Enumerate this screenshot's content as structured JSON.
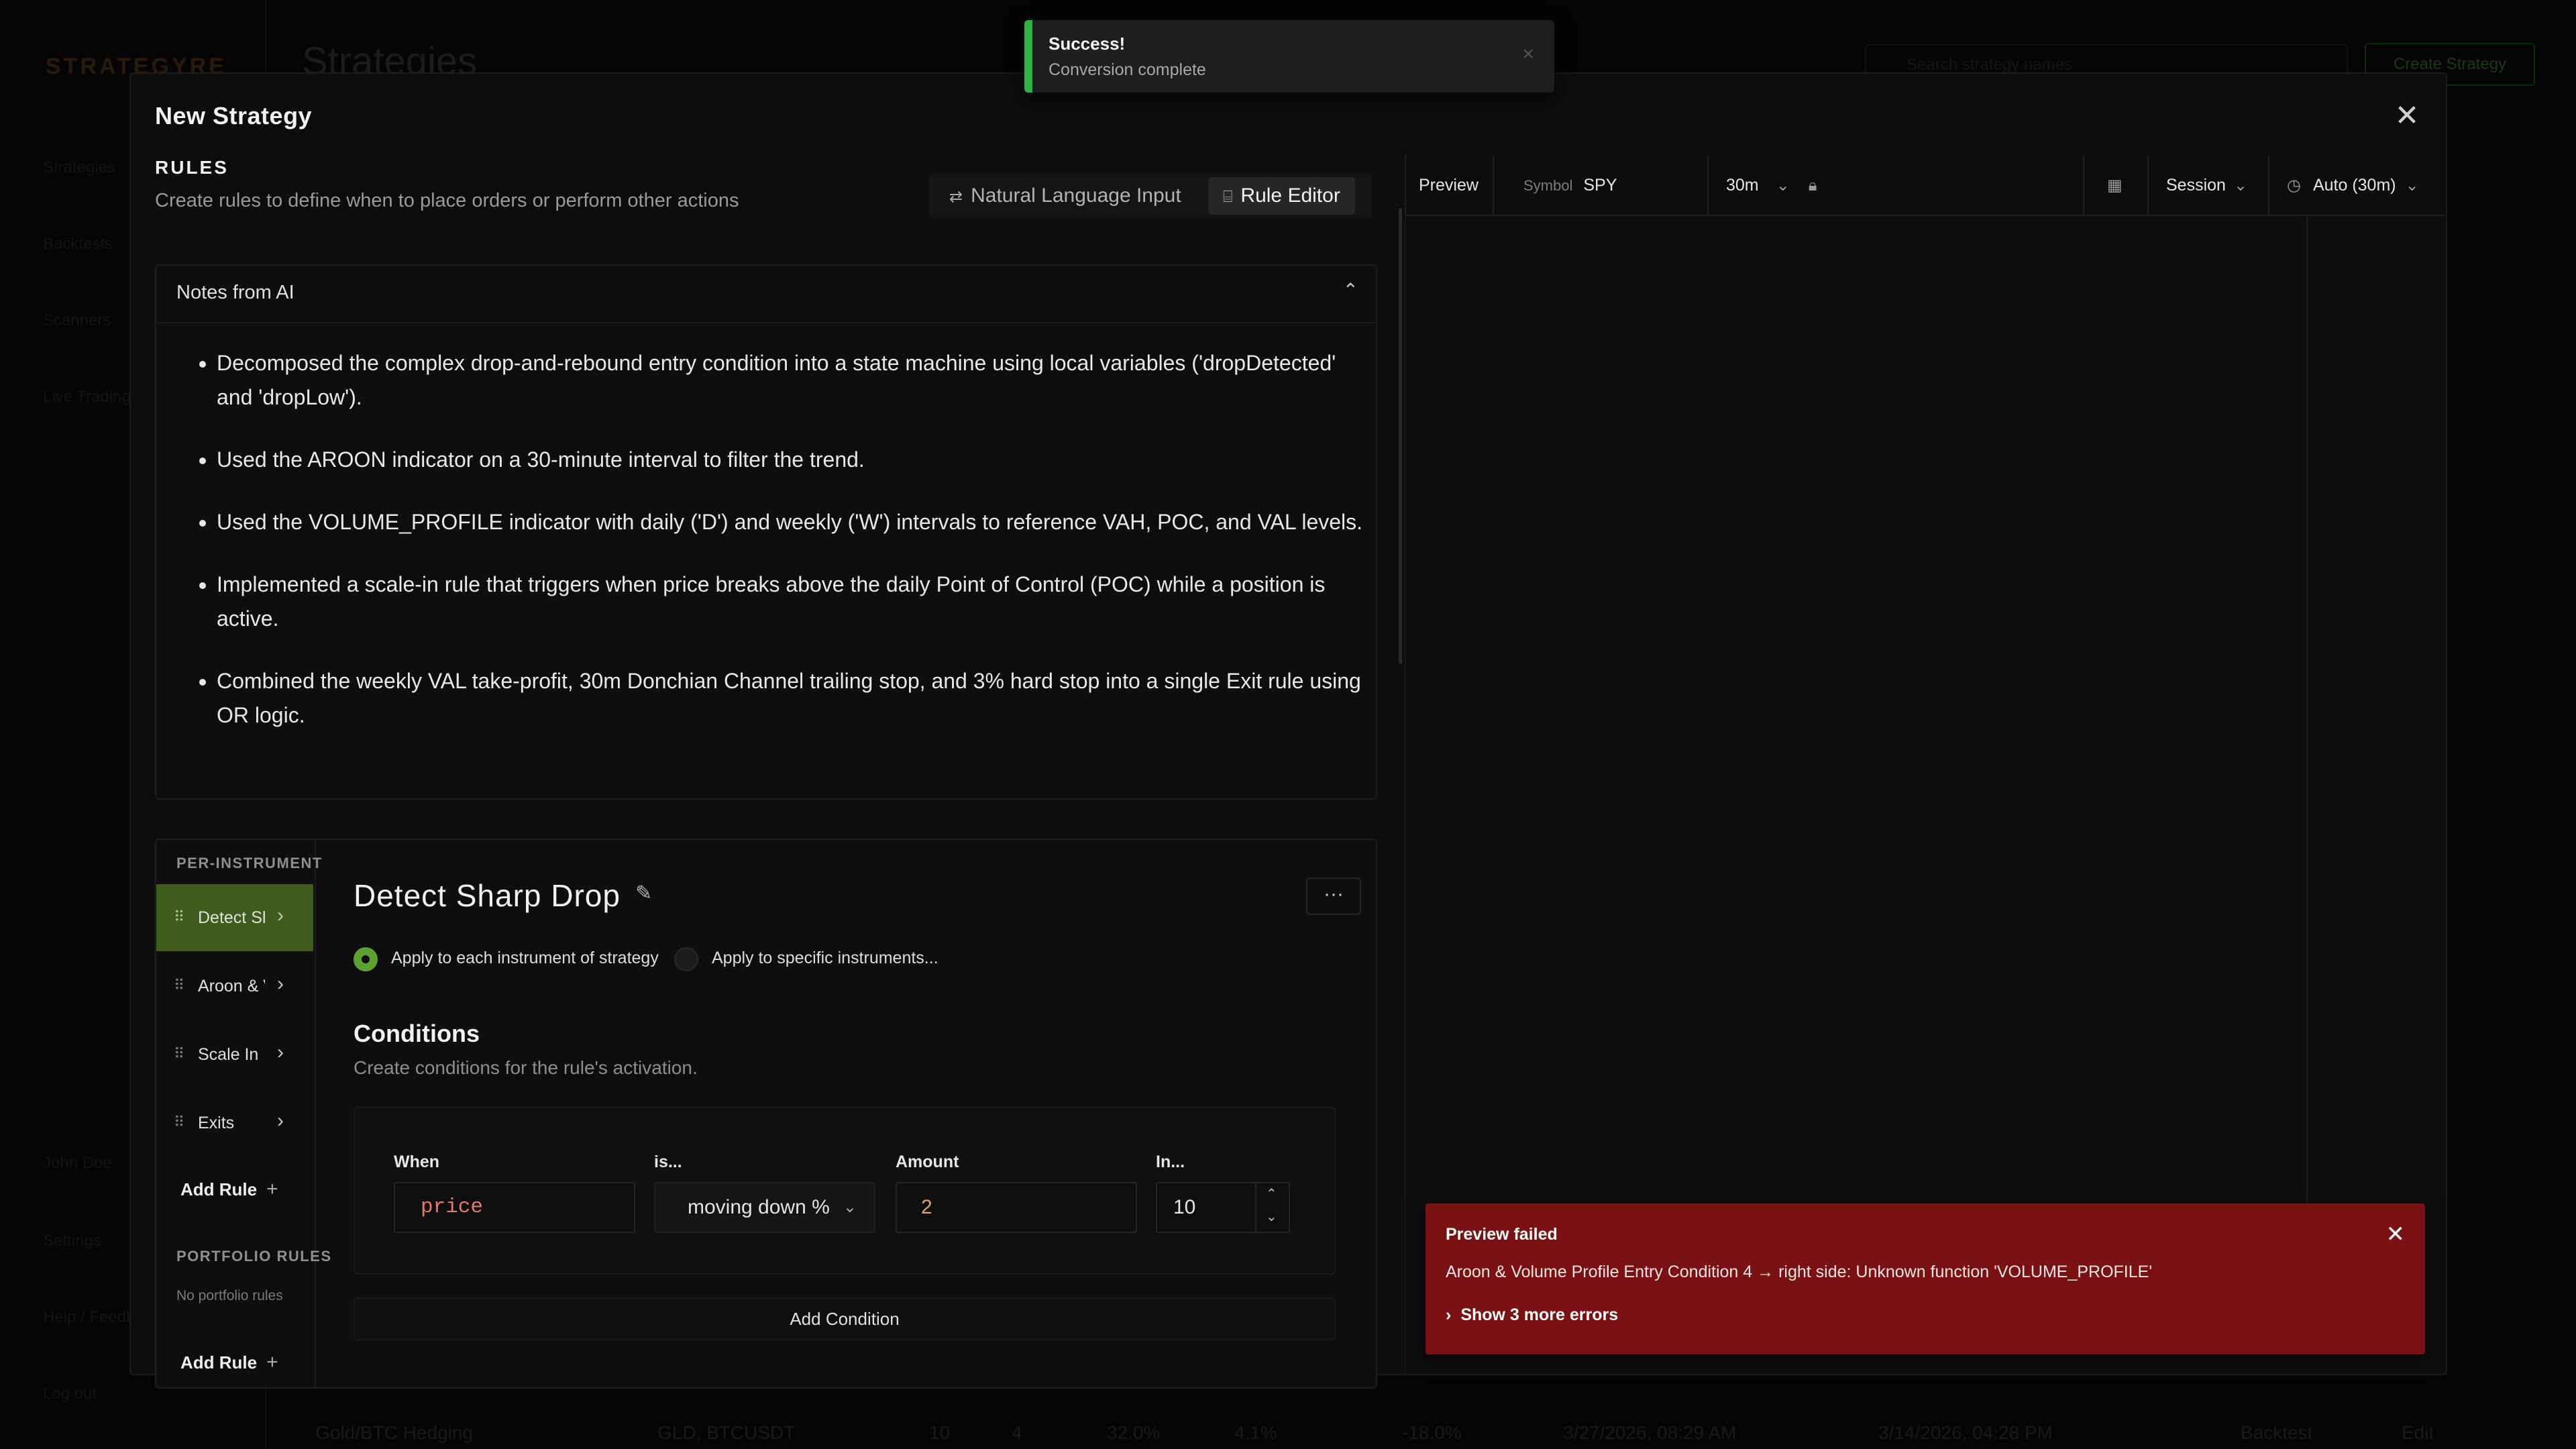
{
  "background": {
    "logo": "STRATEGYRE",
    "title": "Strategies",
    "search_placeholder": "Search strategy names",
    "create_button": "Create Strategy",
    "nav": [
      "Strategies",
      "Backtests",
      "Scanners",
      "Live Trading"
    ],
    "nav_bottom": [
      "John Doe",
      "Settings",
      "Help / Feedback",
      "Log out"
    ],
    "row": {
      "name": "Gold/BTC Hedging",
      "instruments": "GLD, BTCUSDT",
      "col1": "10",
      "col2": "4",
      "col3": "32.0%",
      "col4": "4.1%",
      "col5": "-18.0%",
      "created": "3/27/2026, 08:29 AM",
      "updated": "3/14/2026, 04:28 PM",
      "backtest": "Backtest",
      "edit": "Edit"
    }
  },
  "toast": {
    "title": "Success!",
    "message": "Conversion complete",
    "close_icon": "×"
  },
  "modal": {
    "title": "New Strategy",
    "close_icon": "✕"
  },
  "rules": {
    "heading": "RULES",
    "subtitle": "Create rules to define when to place orders or perform other actions",
    "mode_tabs": [
      {
        "icon": "⇄",
        "label": "Natural Language Input"
      },
      {
        "icon": "⌸",
        "label": "Rule Editor"
      }
    ],
    "active_mode": "Rule Editor"
  },
  "notes": {
    "title": "Notes from AI",
    "chevron": "⌃",
    "items": [
      "Decomposed the complex drop-and-rebound entry condition into a state machine using local variables ('dropDetected' and 'dropLow').",
      "Used the AROON indicator on a 30-minute interval to filter the trend.",
      "Used the VOLUME_PROFILE indicator with daily ('D') and weekly ('W') intervals to reference VAH, POC, and VAL levels.",
      "Implemented a scale-in rule that triggers when price breaks above the daily Point of Control (POC) while a position is active.",
      "Combined the weekly VAL take-profit, 30m Donchian Channel trailing stop, and 3% hard stop into a single Exit rule using OR logic."
    ]
  },
  "rule_list": {
    "per_instrument_heading": "PER-INSTRUMENT",
    "items": [
      "Detect Sharp Drop",
      "Aroon & Volume Profile Entry",
      "Scale In",
      "Exits"
    ],
    "add_rule": "Add Rule",
    "portfolio_heading": "PORTFOLIO RULES",
    "no_portfolio": "No portfolio rules",
    "add_portfolio_rule": "Add Rule",
    "grip": "⠿",
    "chevron": "›",
    "plus": "+"
  },
  "rule_detail": {
    "name": "Detect Sharp Drop",
    "pencil": "✎",
    "more": "···",
    "scope_each": "Apply to each instrument of strategy",
    "scope_specific": "Apply to specific instruments...",
    "conditions_title": "Conditions",
    "conditions_subtitle": "Create conditions for the rule's activation.",
    "condition": {
      "when_label": "When",
      "when_value": "price",
      "is_label": "is...",
      "is_value": "moving down %",
      "amount_label": "Amount",
      "amount_value": "2",
      "in_label": "In...",
      "in_value": "10"
    },
    "add_condition": "Add Condition"
  },
  "preview": {
    "tab": "Preview",
    "symbol_label": "Symbol",
    "symbol": "SPY",
    "interval": "30m",
    "session": "Session",
    "auto": "Auto (30m)",
    "error": {
      "title": "Preview failed",
      "message": "Aroon & Volume Profile Entry Condition 4 → right side: Unknown function 'VOLUME_PROFILE'",
      "more": "Show 3 more errors"
    }
  }
}
